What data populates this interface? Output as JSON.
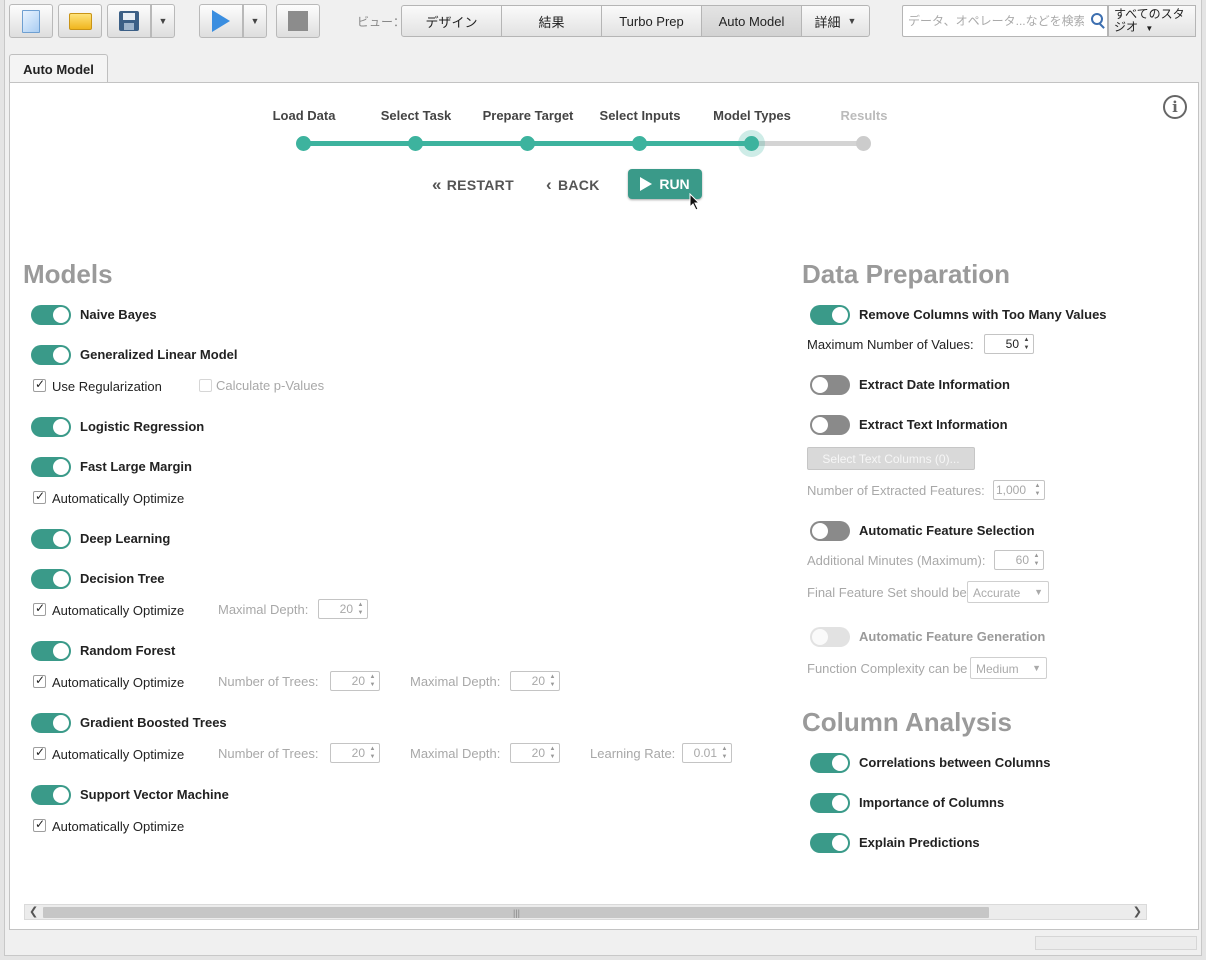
{
  "toolbar": {
    "view_label": "ビュー：",
    "views": [
      "デザイン",
      "結果",
      "Turbo Prep",
      "Auto Model",
      "詳細"
    ],
    "search_placeholder": "データ、オペレータ...などを検索",
    "studio_label": "すべてのスタジオ"
  },
  "tab": {
    "label": "Auto Model"
  },
  "wizard": {
    "steps": [
      "Load Data",
      "Select Task",
      "Prepare Target",
      "Select Inputs",
      "Model Types",
      "Results"
    ],
    "current_step": 5,
    "restart_label": "RESTART",
    "back_label": "BACK",
    "run_label": "RUN",
    "accent_color": "#3db39e",
    "inactive_color": "#cccccc"
  },
  "models": {
    "title": "Models",
    "naive_bayes": "Naive Bayes",
    "glm": "Generalized Linear Model",
    "use_regularization": "Use Regularization",
    "calc_pvalues": "Calculate p-Values",
    "logistic": "Logistic Regression",
    "flm": "Fast Large Margin",
    "auto_opt": "Automatically Optimize",
    "deep_learning": "Deep Learning",
    "decision_tree": "Decision Tree",
    "random_forest": "Random Forest",
    "gbt": "Gradient Boosted Trees",
    "svm": "Support Vector Machine",
    "max_depth_label": "Maximal Depth:",
    "num_trees_label": "Number of Trees:",
    "learning_rate_label": "Learning Rate:",
    "dt_depth": "20",
    "rf_trees": "20",
    "rf_depth": "20",
    "gbt_trees": "20",
    "gbt_depth": "20",
    "gbt_rate": "0.01"
  },
  "prep": {
    "title": "Data Preparation",
    "remove_cols": "Remove Columns with Too Many Values",
    "max_values_label": "Maximum Number of Values:",
    "max_values": "50",
    "extract_date": "Extract Date Information",
    "extract_text": "Extract Text Information",
    "select_text_cols": "Select Text Columns (0)...",
    "num_features_label": "Number of Extracted Features:",
    "num_features": "1,000",
    "auto_feat_sel": "Automatic Feature Selection",
    "add_minutes_label": "Additional Minutes (Maximum):",
    "add_minutes": "60",
    "final_set_label": "Final Feature Set should be",
    "final_set_value": "Accurate",
    "auto_feat_gen": "Automatic Feature Generation",
    "func_complex_label": "Function Complexity can be",
    "func_complex_value": "Medium"
  },
  "analysis": {
    "title": "Column Analysis",
    "correlations": "Correlations between Columns",
    "importance": "Importance of Columns",
    "explain": "Explain Predictions"
  }
}
